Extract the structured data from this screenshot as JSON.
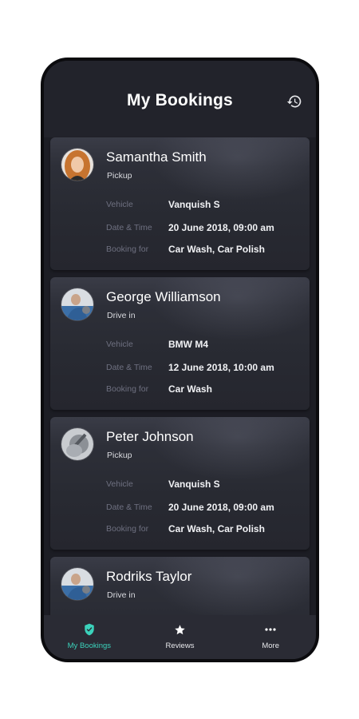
{
  "header": {
    "title": "My Bookings",
    "history_icon": "history-icon"
  },
  "labels": {
    "vehicle": "Vehicle",
    "datetime": "Date & Time",
    "booking_for": "Booking for"
  },
  "bookings": [
    {
      "name": "Samantha Smith",
      "type": "Pickup",
      "vehicle": "Vanquish S",
      "datetime": "20 June 2018, 09:00 am",
      "services": "Car Wash, Car Polish"
    },
    {
      "name": "George Williamson",
      "type": "Drive in",
      "vehicle": "BMW M4",
      "datetime": "12 June 2018, 10:00 am",
      "services": "Car Wash"
    },
    {
      "name": "Peter Johnson",
      "type": "Pickup",
      "vehicle": "Vanquish S",
      "datetime": "20 June 2018, 09:00 am",
      "services": "Car Wash, Car Polish"
    },
    {
      "name": "Rodriks Taylor",
      "type": "Drive in"
    }
  ],
  "nav": [
    {
      "label": "My Bookings",
      "icon": "shield-check-icon",
      "active": true
    },
    {
      "label": "Reviews",
      "icon": "star-icon"
    },
    {
      "label": "More",
      "icon": "more-dots-icon"
    }
  ],
  "colors": {
    "accent": "#3bd2bb",
    "background": "#1c1d24",
    "card": "#2b2d36"
  }
}
